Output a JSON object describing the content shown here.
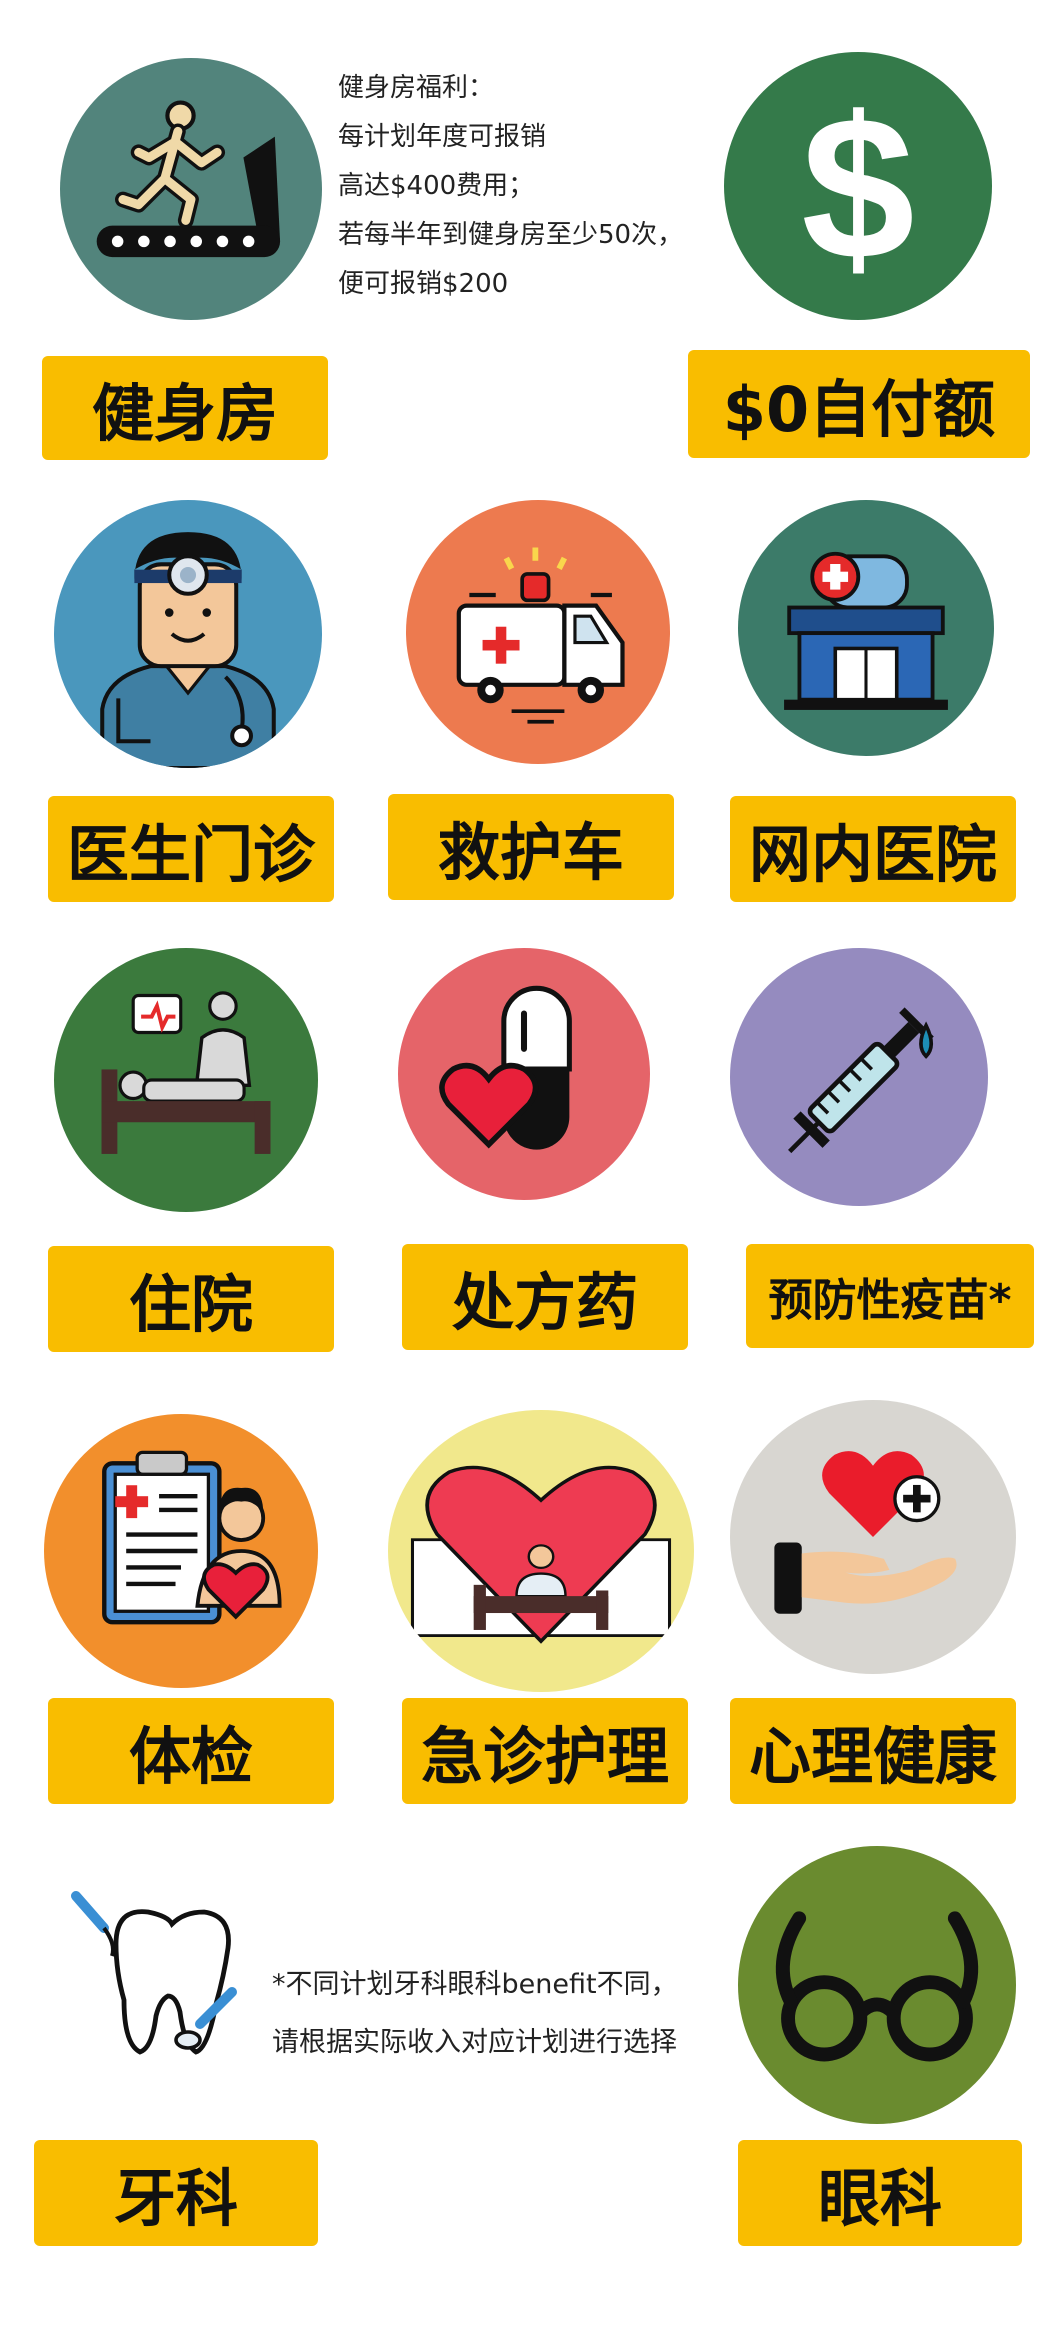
{
  "benefits": {
    "gym": {
      "label": "健身房",
      "icon": "treadmill-icon",
      "color": "#52847c"
    },
    "copay": {
      "label": "$0自付额",
      "icon": "dollar-icon",
      "color": "#347a4a"
    },
    "doctor": {
      "label": "医生门诊",
      "icon": "doctor-icon",
      "color": "#4a97bd"
    },
    "ambulance": {
      "label": "救护车",
      "icon": "ambulance-icon",
      "color": "#ed7a4f"
    },
    "network_hospital": {
      "label": "网内医院",
      "icon": "hospital-building-icon",
      "color": "#3c7b69"
    },
    "inpatient": {
      "label": "住院",
      "icon": "hospital-bed-icon",
      "color": "#3b7a3d"
    },
    "rx": {
      "label": "处方药",
      "icon": "pill-heart-icon",
      "color": "#e56469"
    },
    "vaccine": {
      "label": "预防性疫苗*",
      "icon": "syringe-icon",
      "color": "#958bbf"
    },
    "checkup": {
      "label": "体检",
      "icon": "clipboard-checkup-icon",
      "color": "#f28f2c"
    },
    "urgent_care": {
      "label": "急诊护理",
      "icon": "heart-bed-icon",
      "color": "#f1e88c"
    },
    "mental_health": {
      "label": "心理健康",
      "icon": "hand-heart-icon",
      "color": "#d8d6d1"
    },
    "dental": {
      "label": "牙科",
      "icon": "tooth-icon",
      "color": "#ffffff"
    },
    "vision": {
      "label": "眼科",
      "icon": "glasses-icon",
      "color": "#6a8b2f"
    }
  },
  "gym_note": [
    "健身房福利：",
    "每计划年度可报销",
    "高达$400费用；",
    "若每半年到健身房至少50次，",
    "便可报销$200"
  ],
  "dental_note": [
    "*不同计划牙科眼科benefit不同，",
    "请根据实际收入对应计划进行选择"
  ],
  "colors": {
    "label_bg": "#f9bd00"
  }
}
